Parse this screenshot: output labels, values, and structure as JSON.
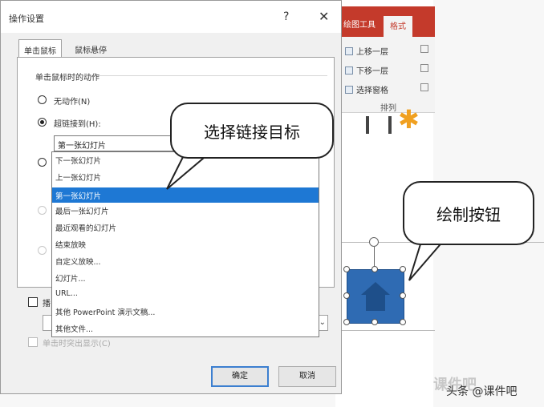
{
  "dialog": {
    "title": "操作设置",
    "help": "?",
    "close": "✕",
    "tabs": [
      "单击鼠标",
      "鼠标悬停"
    ],
    "group_label": "单击鼠标时的动作",
    "options": {
      "none": "无动作(N)",
      "hyperlink": "超链接到(H):"
    },
    "hyperlink_value": "第一张幻灯片",
    "hyperlink_list": [
      "下一张幻灯片",
      "上一张幻灯片",
      "第一张幻灯片",
      "最后一张幻灯片",
      "最近观看的幻灯片",
      "结束放映",
      "自定义放映...",
      "幻灯片...",
      "URL...",
      "其他 PowerPoint 演示文稿...",
      "其他文件..."
    ],
    "selected_index": 2,
    "checkbox_partial": "播",
    "highlight_check": "单击时突出显示(C)",
    "ok": "确定",
    "cancel": "取消"
  },
  "ribbon": {
    "tab_draw": "绘图工具",
    "tab_format": "格式",
    "bring_forward": "上移一层",
    "send_backward": "下移一层",
    "selection_pane": "选择窗格",
    "group_label": "排列"
  },
  "callouts": {
    "choose_target": "选择链接目标",
    "draw_button": "绘制按钮"
  },
  "watermark": {
    "text": "头条 @课件吧",
    "mark": "课件吧"
  },
  "colors": {
    "accent_red": "#c43a2b",
    "selection_blue": "#1e78d4",
    "shape_blue": "#2f6bb3"
  }
}
